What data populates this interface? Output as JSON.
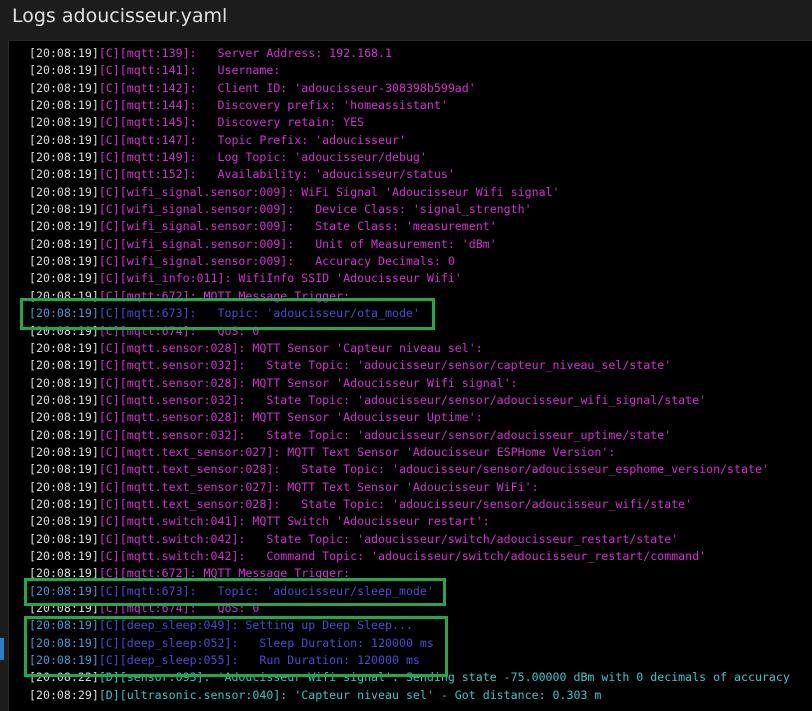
{
  "window": {
    "title": "Logs adoucisseur.yaml"
  },
  "colors": {
    "config": "#d42fd4",
    "debug": "#35c9c9",
    "verbose": "#4a4ad8",
    "timestamp": "#dddddd",
    "highlight": "#22a84a"
  },
  "log": {
    "lines": [
      {
        "ts": "[20:08:19]",
        "lv": "[C]",
        "msg": "[mqtt:139]:   Server Address: 192.168.1",
        "level": "C"
      },
      {
        "ts": "[20:08:19]",
        "lv": "[C]",
        "msg": "[mqtt:141]:   Username:",
        "level": "C"
      },
      {
        "ts": "[20:08:19]",
        "lv": "[C]",
        "msg": "[mqtt:142]:   Client ID: 'adoucisseur-308398b599ad'",
        "level": "C"
      },
      {
        "ts": "[20:08:19]",
        "lv": "[C]",
        "msg": "[mqtt:144]:   Discovery prefix: 'homeassistant'",
        "level": "C"
      },
      {
        "ts": "[20:08:19]",
        "lv": "[C]",
        "msg": "[mqtt:145]:   Discovery retain: YES",
        "level": "C"
      },
      {
        "ts": "[20:08:19]",
        "lv": "[C]",
        "msg": "[mqtt:147]:   Topic Prefix: 'adoucisseur'",
        "level": "C"
      },
      {
        "ts": "[20:08:19]",
        "lv": "[C]",
        "msg": "[mqtt:149]:   Log Topic: 'adoucisseur/debug'",
        "level": "C"
      },
      {
        "ts": "[20:08:19]",
        "lv": "[C]",
        "msg": "[mqtt:152]:   Availability: 'adoucisseur/status'",
        "level": "C"
      },
      {
        "ts": "[20:08:19]",
        "lv": "[C]",
        "msg": "[wifi_signal.sensor:009]: WiFi Signal 'Adoucisseur Wifi signal'",
        "level": "C"
      },
      {
        "ts": "[20:08:19]",
        "lv": "[C]",
        "msg": "[wifi_signal.sensor:009]:   Device Class: 'signal_strength'",
        "level": "C"
      },
      {
        "ts": "[20:08:19]",
        "lv": "[C]",
        "msg": "[wifi_signal.sensor:009]:   State Class: 'measurement'",
        "level": "C"
      },
      {
        "ts": "[20:08:19]",
        "lv": "[C]",
        "msg": "[wifi_signal.sensor:009]:   Unit of Measurement: 'dBm'",
        "level": "C"
      },
      {
        "ts": "[20:08:19]",
        "lv": "[C]",
        "msg": "[wifi_signal.sensor:009]:   Accuracy Decimals: 0",
        "level": "C"
      },
      {
        "ts": "[20:08:19]",
        "lv": "[C]",
        "msg": "[wifi_info:011]: WifiInfo SSID 'Adoucisseur Wifi'",
        "level": "C"
      },
      {
        "ts": "[20:08:19]",
        "lv": "[C]",
        "msg": "[mqtt:672]: MQTT Message Trigger:",
        "level": "C"
      },
      {
        "ts": "[20:08:19]",
        "lv": "[C]",
        "msg": "[mqtt:673]:   Topic: 'adoucisseur/ota_mode'",
        "level": "V"
      },
      {
        "ts": "[20:08:19]",
        "lv": "[C]",
        "msg": "[mqtt:674]:   QoS: 0",
        "level": "C"
      },
      {
        "ts": "[20:08:19]",
        "lv": "[C]",
        "msg": "[mqtt.sensor:028]: MQTT Sensor 'Capteur niveau sel':",
        "level": "C"
      },
      {
        "ts": "[20:08:19]",
        "lv": "[C]",
        "msg": "[mqtt.sensor:032]:   State Topic: 'adoucisseur/sensor/capteur_niveau_sel/state'",
        "level": "C"
      },
      {
        "ts": "[20:08:19]",
        "lv": "[C]",
        "msg": "[mqtt.sensor:028]: MQTT Sensor 'Adoucisseur Wifi signal':",
        "level": "C"
      },
      {
        "ts": "[20:08:19]",
        "lv": "[C]",
        "msg": "[mqtt.sensor:032]:   State Topic: 'adoucisseur/sensor/adoucisseur_wifi_signal/state'",
        "level": "C"
      },
      {
        "ts": "[20:08:19]",
        "lv": "[C]",
        "msg": "[mqtt.sensor:028]: MQTT Sensor 'Adoucisseur Uptime':",
        "level": "C"
      },
      {
        "ts": "[20:08:19]",
        "lv": "[C]",
        "msg": "[mqtt.sensor:032]:   State Topic: 'adoucisseur/sensor/adoucisseur_uptime/state'",
        "level": "C"
      },
      {
        "ts": "[20:08:19]",
        "lv": "[C]",
        "msg": "[mqtt.text_sensor:027]: MQTT Text Sensor 'Adoucisseur ESPHome Version':",
        "level": "C"
      },
      {
        "ts": "[20:08:19]",
        "lv": "[C]",
        "msg": "[mqtt.text_sensor:028]:   State Topic: 'adoucisseur/sensor/adoucisseur_esphome_version/state'",
        "level": "C"
      },
      {
        "ts": "[20:08:19]",
        "lv": "[C]",
        "msg": "[mqtt.text_sensor:027]: MQTT Text Sensor 'Adoucisseur WiFi':",
        "level": "C"
      },
      {
        "ts": "[20:08:19]",
        "lv": "[C]",
        "msg": "[mqtt.text_sensor:028]:   State Topic: 'adoucisseur/sensor/adoucisseur_wifi/state'",
        "level": "C"
      },
      {
        "ts": "[20:08:19]",
        "lv": "[C]",
        "msg": "[mqtt.switch:041]: MQTT Switch 'Adoucisseur restart':",
        "level": "C"
      },
      {
        "ts": "[20:08:19]",
        "lv": "[C]",
        "msg": "[mqtt.switch:042]:   State Topic: 'adoucisseur/switch/adoucisseur_restart/state'",
        "level": "C"
      },
      {
        "ts": "[20:08:19]",
        "lv": "[C]",
        "msg": "[mqtt.switch:042]:   Command Topic: 'adoucisseur/switch/adoucisseur_restart/command'",
        "level": "C"
      },
      {
        "ts": "[20:08:19]",
        "lv": "[C]",
        "msg": "[mqtt:672]: MQTT Message Trigger:",
        "level": "C"
      },
      {
        "ts": "[20:08:19]",
        "lv": "[C]",
        "msg": "[mqtt:673]:   Topic: 'adoucisseur/sleep_mode'",
        "level": "V"
      },
      {
        "ts": "[20:08:19]",
        "lv": "[C]",
        "msg": "[mqtt:674]:   QoS: 0",
        "level": "C"
      },
      {
        "ts": "[20:08:19]",
        "lv": "[C]",
        "msg": "[deep_sleep:049]: Setting up Deep Sleep...",
        "level": "V"
      },
      {
        "ts": "[20:08:19]",
        "lv": "[C]",
        "msg": "[deep_sleep:052]:   Sleep Duration: 120000 ms",
        "level": "V"
      },
      {
        "ts": "[20:08:19]",
        "lv": "[C]",
        "msg": "[deep_sleep:055]:   Run Duration: 120000 ms",
        "level": "V"
      },
      {
        "ts": "[20:08:22]",
        "lv": "[D]",
        "msg": "[sensor:093]: 'Adoucisseur Wifi signal': Sending state -75.00000 dBm with 0 decimals of accuracy",
        "level": "D"
      },
      {
        "ts": "[20:08:29]",
        "lv": "[D]",
        "msg": "[ultrasonic.sensor:040]: 'Capteur niveau sel' - Got distance: 0.303 m",
        "level": "D"
      }
    ]
  }
}
